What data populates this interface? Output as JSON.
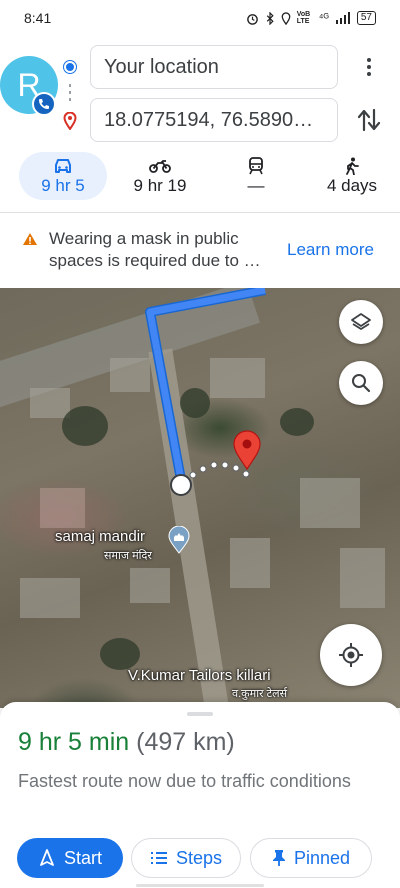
{
  "status_bar": {
    "time": "8:41",
    "icons": [
      "alarm-icon",
      "bluetooth-icon",
      "location-icon",
      "volte-icon",
      "signal-icon",
      "signal-icon",
      "battery-icon"
    ],
    "volte_text": "VoB LTE",
    "network_text": "⁴ᴳ",
    "battery": "57"
  },
  "header": {
    "avatar_letter": "R",
    "origin": "Your location",
    "destination": "18.0775194, 76.5890…"
  },
  "modes": [
    {
      "icon": "car-icon",
      "label": "9 hr 5",
      "active": true
    },
    {
      "icon": "motorcycle-icon",
      "label": "9 hr 19",
      "active": false
    },
    {
      "icon": "transit-icon",
      "label": "—",
      "active": false
    },
    {
      "icon": "walk-icon",
      "label": "4 days",
      "active": false
    }
  ],
  "alert": {
    "message": "Wearing a mask in public spaces is required due to …",
    "link": "Learn more"
  },
  "map": {
    "place1_name": "samaj mandir",
    "place1_local": "समाज मंदिर",
    "place2_name": "V.Kumar Tailors killari",
    "place2_local": "व.कुमार टेलर्स",
    "route_color": "#4285f4",
    "pin_color": "#ea4335"
  },
  "sheet": {
    "duration": "9 hr 5 min",
    "distance": "(497 km)",
    "note": "Fastest route now due to traffic conditions",
    "start_label": "Start",
    "steps_label": "Steps",
    "pinned_label": "Pinned"
  },
  "colors": {
    "accent": "#1a73e8",
    "eta_green": "#188038"
  }
}
